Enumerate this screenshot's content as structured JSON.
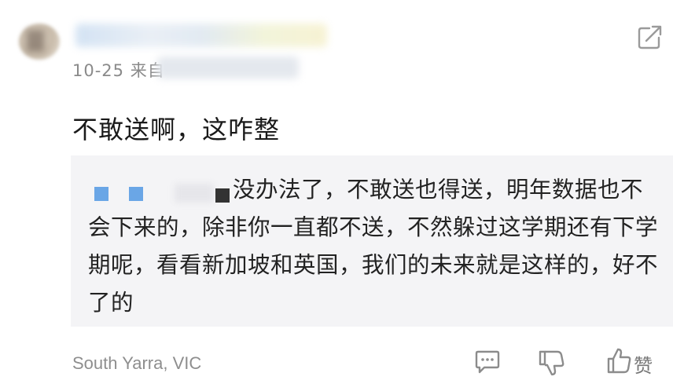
{
  "comment": {
    "date_source": "10-25  来自",
    "text": "不敢送啊，这咋整"
  },
  "reply": {
    "text_line1": "没办法了，不敢送也得送，明年数据也",
    "text_rest": "不会下来的，除非你一直都不送，不然躲过这学期还有下学期呢，看看新加坡和英国，我们的未来就是这样的，好不了的"
  },
  "footer": {
    "location": "South Yarra, VIC",
    "like_label": "赞"
  },
  "icons": {
    "share": "share-icon",
    "comment": "comment-icon",
    "dislike": "thumbs-down-icon",
    "like": "thumbs-up-icon"
  },
  "colors": {
    "reply_background": "#f4f4f6",
    "user_marker": "#6aa6e6"
  }
}
